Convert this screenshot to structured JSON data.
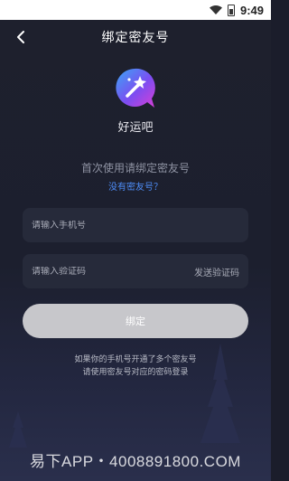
{
  "status_bar": {
    "time": "9:49",
    "wifi_icon": "wifi-icon",
    "battery_icon": "battery-icon"
  },
  "nav": {
    "back_icon": "chevron-left-icon",
    "title": "绑定密友号"
  },
  "app": {
    "logo_icon": "magic-wand-bubble-icon",
    "name": "好运吧"
  },
  "form": {
    "hint": "首次使用请绑定密友号",
    "no_account_link": "没有密友号？",
    "phone_placeholder": "请输入手机号",
    "code_placeholder": "请输入验证码",
    "send_code_label": "发送验证码",
    "bind_button_label": "绑定"
  },
  "notes": {
    "line1": "如果你的手机号开通了多个密友号",
    "line2": "请使用密友号对应的密码登录"
  },
  "watermark": "易下APP・4008891800.COM",
  "colors": {
    "background": "#1c1f2e",
    "field_bg": "#262a3a",
    "link": "#4d8cf5",
    "button_bg": "#c7c7cb"
  }
}
